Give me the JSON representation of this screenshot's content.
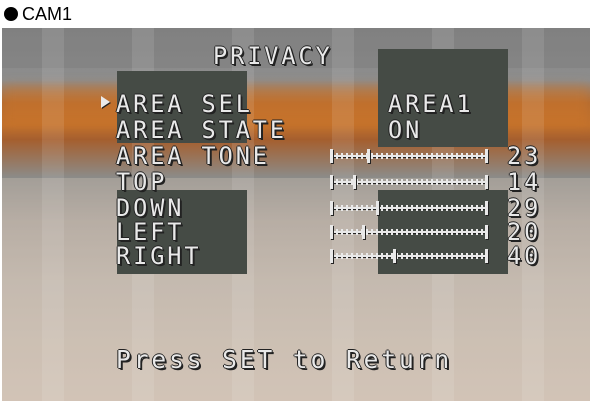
{
  "camera": {
    "label": "CAM1"
  },
  "menu": {
    "title": "PRIVACY",
    "items": [
      {
        "label": "AREA SEL",
        "value": "AREA1",
        "selected": true
      },
      {
        "label": "AREA STATE",
        "value": "ON"
      },
      {
        "label": "AREA TONE",
        "value": "23",
        "level": 23,
        "max": 100
      },
      {
        "label": "TOP",
        "value": "14",
        "level": 14,
        "max": 100
      },
      {
        "label": "DOWN",
        "value": "29",
        "level": 29,
        "max": 100
      },
      {
        "label": "LEFT",
        "value": "20",
        "level": 20,
        "max": 100
      },
      {
        "label": "RIGHT",
        "value": "40",
        "level": 40,
        "max": 100
      }
    ],
    "footer": "Press SET to Return"
  },
  "colors": {
    "osd_text": "#e9e9e9",
    "mask": "#454b45",
    "orange_band": "#c0702c"
  }
}
